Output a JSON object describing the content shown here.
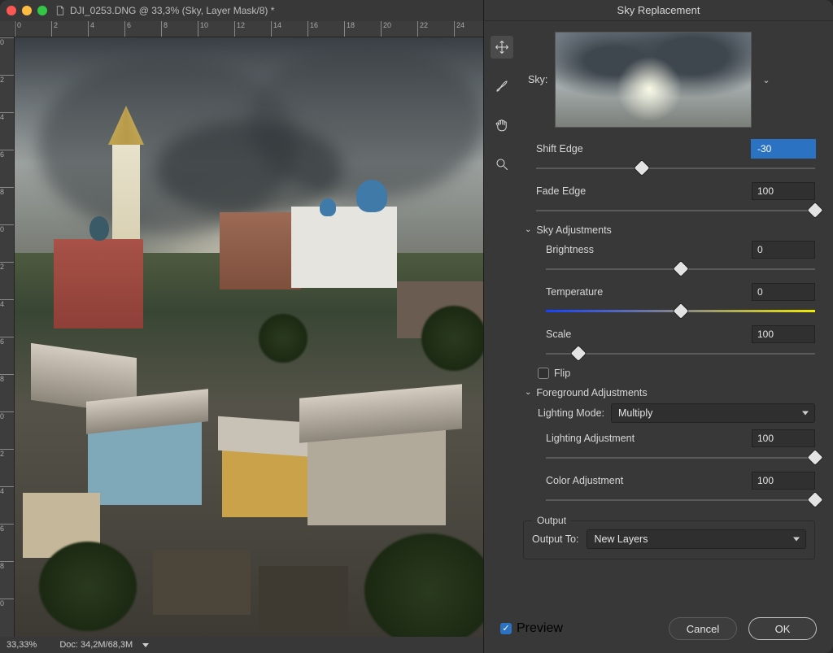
{
  "doc": {
    "title": "DJI_0253.DNG @ 33,3% (Sky, Layer Mask/8) *",
    "zoom": "33,33%",
    "docsize": "Doc: 34,2M/68,3M",
    "h_ticks": [
      "0",
      "2",
      "4",
      "6",
      "8",
      "10",
      "12",
      "14",
      "16",
      "18",
      "20",
      "22",
      "24"
    ],
    "v_ticks": [
      "0",
      "2",
      "4",
      "6",
      "8",
      "0",
      "2",
      "4",
      "6",
      "8",
      "0",
      "2",
      "4",
      "6",
      "8",
      "0"
    ]
  },
  "panel": {
    "title": "Sky Replacement",
    "sky_label": "Sky:",
    "shift_edge": {
      "label": "Shift Edge",
      "value": "-30",
      "pos": 38
    },
    "fade_edge": {
      "label": "Fade Edge",
      "value": "100",
      "pos": 100
    },
    "sky_adj_head": "Sky Adjustments",
    "brightness": {
      "label": "Brightness",
      "value": "0",
      "pos": 50
    },
    "temperature": {
      "label": "Temperature",
      "value": "0",
      "pos": 50
    },
    "scale": {
      "label": "Scale",
      "value": "100",
      "pos": 12
    },
    "flip_label": "Flip",
    "fg_head": "Foreground Adjustments",
    "lighting_mode_label": "Lighting Mode:",
    "lighting_mode_value": "Multiply",
    "lighting_adj": {
      "label": "Lighting Adjustment",
      "value": "100",
      "pos": 100
    },
    "color_adj": {
      "label": "Color Adjustment",
      "value": "100",
      "pos": 100
    },
    "output_head": "Output",
    "output_to_label": "Output To:",
    "output_to_value": "New Layers",
    "preview_label": "Preview",
    "cancel": "Cancel",
    "ok": "OK"
  }
}
